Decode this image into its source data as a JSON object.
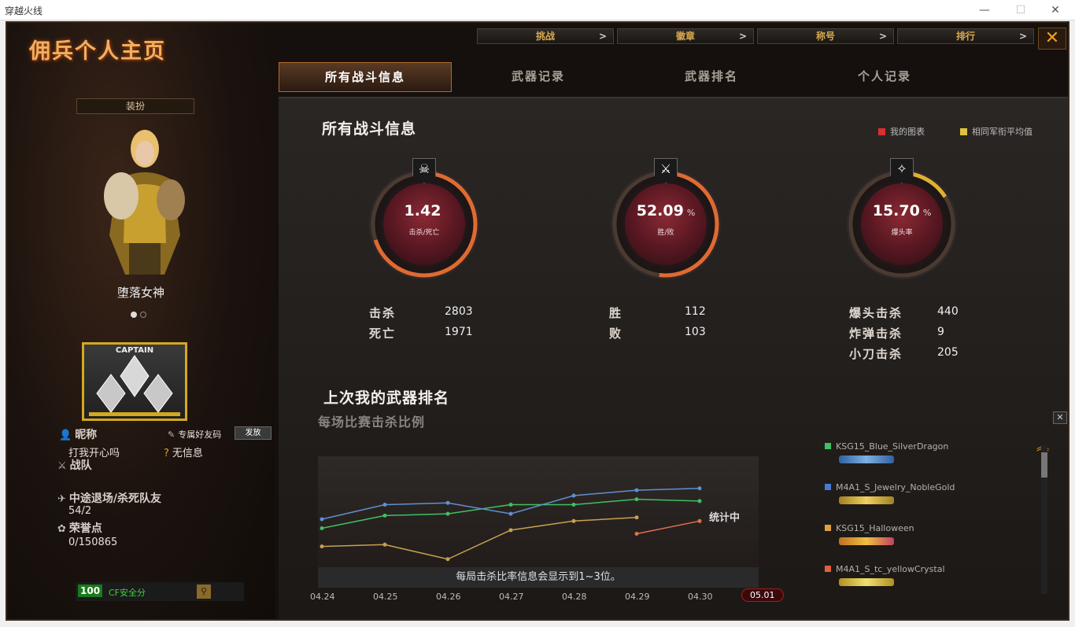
{
  "os_window": {
    "title": "穿越火线",
    "minimize": "—",
    "maximize": "☐",
    "close": "✕"
  },
  "page_title": "佣兵个人主页",
  "top_tabs": [
    {
      "label": "挑战",
      "arrow": ">"
    },
    {
      "label": "徽章",
      "arrow": ">"
    },
    {
      "label": "称号",
      "arrow": ">"
    },
    {
      "label": "排行",
      "arrow": ">"
    }
  ],
  "close_label": "✕",
  "main_tabs": [
    "所有战斗信息",
    "武器记录",
    "武器排名",
    "个人记录"
  ],
  "sidebar": {
    "dress_label": "装扮",
    "character_name": "堕落女神",
    "rank_label": "CAPTAIN",
    "nickname_label": "昵称",
    "nickname_value": "打我开心吗",
    "friend_code_label": "专属好友码",
    "send_label": "发放",
    "no_info": "无信息",
    "team_label": "战队",
    "quit_label": "中途退场/杀死队友",
    "quit_value": "54/2",
    "honor_label": "荣誉点",
    "honor_value": "0/150865",
    "cf_score": "100",
    "cf_label": "CF安全分"
  },
  "main": {
    "section_title": "所有战斗信息",
    "legend": [
      {
        "label": "我的图表",
        "color": "#d83030"
      },
      {
        "label": "相同军衔平均值",
        "color": "#e0c040"
      }
    ],
    "gauges": [
      {
        "value": "1.42",
        "pct": "",
        "label": "击杀/死亡",
        "icon": "☠",
        "fraction": 0.7
      },
      {
        "value": "52.09",
        "pct": "%",
        "label": "胜/败",
        "icon": "⚔",
        "fraction": 0.52
      },
      {
        "value": "15.70",
        "pct": "%",
        "label": "爆头率",
        "icon": "✧",
        "fraction": 0.16
      }
    ],
    "stats": {
      "kill_label": "击杀",
      "kill_value": "2803",
      "death_label": "死亡",
      "death_value": "1971",
      "win_label": "胜",
      "win_value": "112",
      "lose_label": "败",
      "lose_value": "103",
      "hs_label": "爆头击杀",
      "hs_value": "440",
      "bomb_label": "炸弹击杀",
      "bomb_value": "9",
      "knife_label": "小刀击杀",
      "knife_value": "205"
    },
    "weapon_rank_title": "上次我的武器排名",
    "kill_ratio_title": "每场比赛击杀比例",
    "chart_note": "每局击杀比率信息会显示到1~3位。",
    "in_progress": "统计中",
    "weapons": [
      {
        "name": "KSG15_Blue_SilverDragon",
        "color": "#40c060",
        "gun_color": "#4a8ad0"
      },
      {
        "name": "M4A1_S_Jewelry_NobleGold",
        "color": "#4a7ad0",
        "gun_color": "#c0a030"
      },
      {
        "name": "KSG15_Halloween",
        "color": "#e0a040",
        "gun_color": "#d0a030"
      },
      {
        "name": "M4A1_S_tc_yellowCrystal",
        "color": "#e06040",
        "gun_color": "#d0b040"
      }
    ]
  },
  "chart_data": {
    "type": "line",
    "title": "每场比赛击杀比例",
    "x": [
      "04.24",
      "04.25",
      "04.26",
      "04.27",
      "04.28",
      "04.29",
      "04.30",
      "05.01"
    ],
    "series": [
      {
        "name": "KSG15_Blue_SilverDragon",
        "color": "#40c060",
        "values": [
          1.05,
          1.4,
          1.45,
          1.7,
          1.7,
          1.85,
          1.8,
          null
        ]
      },
      {
        "name": "M4A1_S_Jewelry_NobleGold",
        "color": "#6090d0",
        "values": [
          1.3,
          1.7,
          1.75,
          1.45,
          1.95,
          2.1,
          2.15,
          null
        ]
      },
      {
        "name": "KSG15_Halloween",
        "color": "#c8a050",
        "values": [
          0.55,
          0.6,
          0.2,
          1.0,
          1.25,
          1.35,
          null,
          null
        ]
      },
      {
        "name": "M4A1_S_tc_yellowCrystal",
        "color": "#e07050",
        "values": [
          null,
          null,
          null,
          null,
          null,
          0.9,
          1.25,
          null
        ]
      }
    ],
    "ylim": [
      0,
      2.6
    ],
    "selected": "05.01",
    "grid": false
  }
}
